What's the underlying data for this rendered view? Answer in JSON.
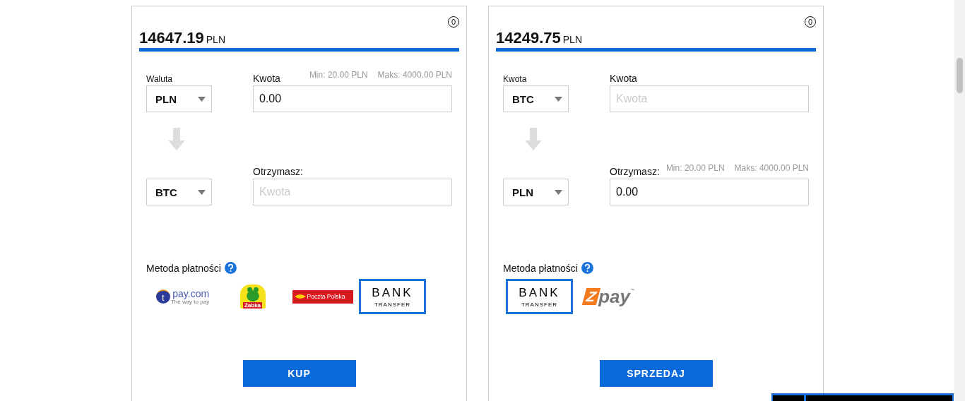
{
  "cards": [
    {
      "balance": "14647.19",
      "currency": "PLN",
      "badge": "0",
      "selects": [
        {
          "label": "Waluta",
          "value": "PLN"
        },
        {
          "value": "BTC"
        }
      ],
      "fields": [
        {
          "label": "Kwota",
          "min": "Min: 20.00 PLN",
          "max": "Maks: 4000.00 PLN",
          "value": "0.00"
        },
        {
          "label": "Otrzymasz:",
          "placeholder": "Kwota"
        }
      ],
      "payment_label": "Metoda płatności",
      "methods": [
        {
          "kind": "tpay",
          "texts": [
            "t",
            "pay.com",
            "The way to pay"
          ],
          "selected": false
        },
        {
          "kind": "zabka",
          "texts": [
            "Żabka"
          ],
          "selected": false
        },
        {
          "kind": "poczta",
          "texts": [
            "Poczta Polska"
          ],
          "selected": false
        },
        {
          "kind": "bank",
          "texts": [
            "BANK",
            "TRANSFER"
          ],
          "selected": true
        }
      ],
      "button": "KUP"
    },
    {
      "balance": "14249.75",
      "currency": "PLN",
      "badge": "0",
      "selects": [
        {
          "label": "Kwota",
          "value": "BTC"
        },
        {
          "value": "PLN"
        }
      ],
      "fields": [
        {
          "label": "Kwota",
          "placeholder": "Kwota"
        },
        {
          "label": "Otrzymasz:",
          "min": "Min: 20.00 PLN",
          "max": "Maks: 4000.00 PLN",
          "value": "0.00"
        }
      ],
      "payment_label": "Metoda płatności",
      "methods": [
        {
          "kind": "bank",
          "texts": [
            "BANK",
            "TRANSFER"
          ],
          "selected": true
        },
        {
          "kind": "zpay",
          "texts": [
            "Z",
            "pay",
            "™"
          ],
          "selected": false
        }
      ],
      "button": "SPRZEDAJ"
    }
  ]
}
